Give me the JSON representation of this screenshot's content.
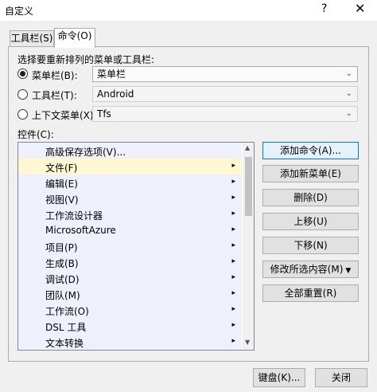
{
  "window": {
    "title": "自定义",
    "help": "?",
    "close": "✕"
  },
  "tabs": [
    {
      "label": "工具栏(S)",
      "active": false
    },
    {
      "label": "命令(O)",
      "active": true
    }
  ],
  "section_label": "选择要重新排列的菜单或工具栏:",
  "options": [
    {
      "label": "菜单栏(B):",
      "checked": true,
      "value": "菜单栏"
    },
    {
      "label": "工具栏(T):",
      "checked": false,
      "value": "Android"
    },
    {
      "label": "上下文菜单(X):",
      "checked": false,
      "value": "Tfs"
    }
  ],
  "controls_label": "控件(C):",
  "list_items": [
    {
      "label": "高级保存选项(V)...",
      "submenu": false,
      "selected": false
    },
    {
      "label": "文件(F)",
      "submenu": true,
      "selected": true
    },
    {
      "label": "编辑(E)",
      "submenu": true,
      "selected": false
    },
    {
      "label": "视图(V)",
      "submenu": true,
      "selected": false
    },
    {
      "label": "工作流设计器",
      "submenu": true,
      "selected": false
    },
    {
      "label": "MicrosoftAzure",
      "submenu": true,
      "selected": false
    },
    {
      "label": "项目(P)",
      "submenu": true,
      "selected": false
    },
    {
      "label": "生成(B)",
      "submenu": true,
      "selected": false
    },
    {
      "label": "调试(D)",
      "submenu": true,
      "selected": false
    },
    {
      "label": "团队(M)",
      "submenu": true,
      "selected": false
    },
    {
      "label": "工作流(O)",
      "submenu": true,
      "selected": false
    },
    {
      "label": "DSL 工具",
      "submenu": true,
      "selected": false
    },
    {
      "label": "文本转换",
      "submenu": true,
      "selected": false
    }
  ],
  "buttons": {
    "add_command": "添加命令(A)...",
    "add_menu": "添加新菜单(E)",
    "delete": "删除(D)",
    "move_up": "上移(U)",
    "move_down": "下移(N)",
    "modify": "修改所选内容(M)",
    "reset_all": "全部重置(R)"
  },
  "footer": {
    "keyboard": "键盘(K)...",
    "close": "关闭"
  },
  "icons": {
    "submenu_arrow": "▸",
    "dropdown": "⌄",
    "scroll_up": "▲",
    "scroll_down": "▼",
    "caret": "▼"
  },
  "colors": {
    "accent": "#0078d7",
    "selected_item": "#fff7d1",
    "list_item_bg": "#eef0fb"
  }
}
